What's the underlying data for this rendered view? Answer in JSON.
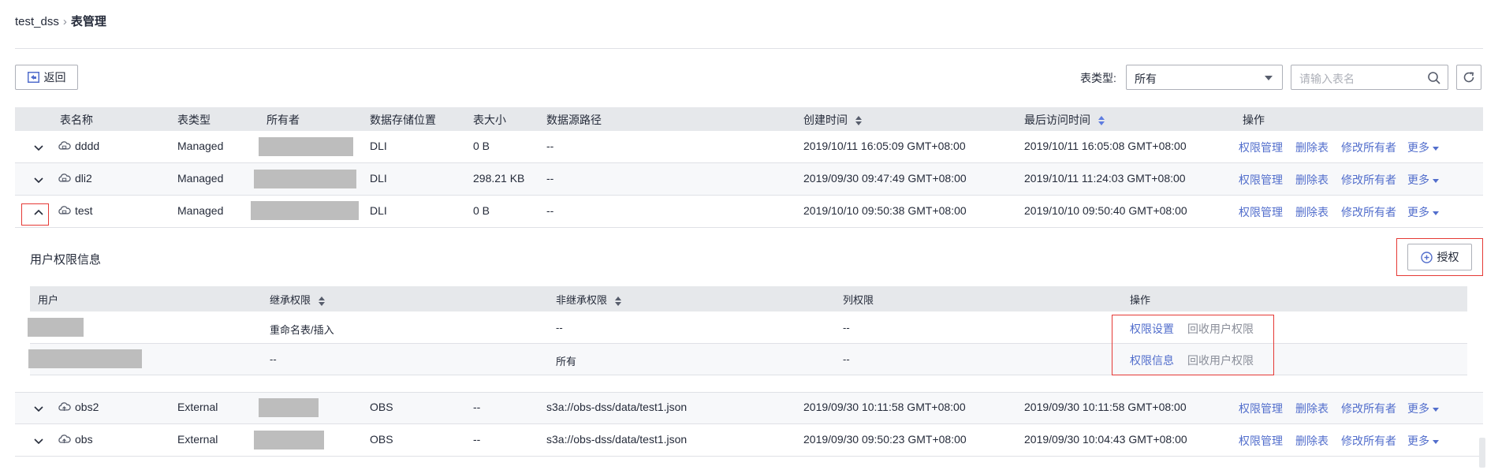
{
  "breadcrumb": {
    "db": "test_dss",
    "separator": "›",
    "page": "表管理"
  },
  "toolbar": {
    "back_label": "返回",
    "type_label": "表类型:",
    "type_value": "所有",
    "search_placeholder": "请输入表名"
  },
  "table": {
    "columns": [
      "表名称",
      "表类型",
      "所有者",
      "数据存储位置",
      "表大小",
      "数据源路径",
      "创建时间",
      "最后访问时间",
      "操作"
    ],
    "actions": {
      "perm": "权限管理",
      "delete": "删除表",
      "owner": "修改所有者",
      "more": "更多"
    },
    "rows": [
      {
        "name": "dddd",
        "type": "Managed",
        "location": "DLI",
        "size": "0 B",
        "path": "--",
        "created": "2019/10/11 16:05:09 GMT+08:00",
        "accessed": "2019/10/11 16:05:08 GMT+08:00"
      },
      {
        "name": "dli2",
        "type": "Managed",
        "location": "DLI",
        "size": "298.21 KB",
        "path": "--",
        "created": "2019/09/30 09:47:49 GMT+08:00",
        "accessed": "2019/10/11 11:24:03 GMT+08:00"
      },
      {
        "name": "test",
        "type": "Managed",
        "location": "DLI",
        "size": "0 B",
        "path": "--",
        "created": "2019/10/10 09:50:38 GMT+08:00",
        "accessed": "2019/10/10 09:50:40 GMT+08:00"
      },
      {
        "name": "obs2",
        "type": "External",
        "location": "OBS",
        "size": "--",
        "path": "s3a://obs-dss/data/test1.json",
        "created": "2019/09/30 10:11:58 GMT+08:00",
        "accessed": "2019/09/30 10:11:58 GMT+08:00"
      },
      {
        "name": "obs",
        "type": "External",
        "location": "OBS",
        "size": "--",
        "path": "s3a://obs-dss/data/test1.json",
        "created": "2019/09/30 09:50:23 GMT+08:00",
        "accessed": "2019/09/30 10:04:43 GMT+08:00"
      }
    ]
  },
  "permissions": {
    "title": "用户权限信息",
    "grant_label": "授权",
    "columns": [
      "用户",
      "继承权限",
      "非继承权限",
      "列权限",
      "操作"
    ],
    "rows": [
      {
        "inherited": "重命名表/插入",
        "non_inherited": "--",
        "column": "--",
        "action1": "权限设置",
        "action2": "回收用户权限"
      },
      {
        "inherited": "--",
        "non_inherited": "所有",
        "column": "--",
        "action1": "权限信息",
        "action2": "回收用户权限"
      }
    ]
  },
  "colors": {
    "link": "#526ecc",
    "header_bg": "#e6e8eb",
    "highlight": "#e53935",
    "mask": "#bdbdbd"
  }
}
